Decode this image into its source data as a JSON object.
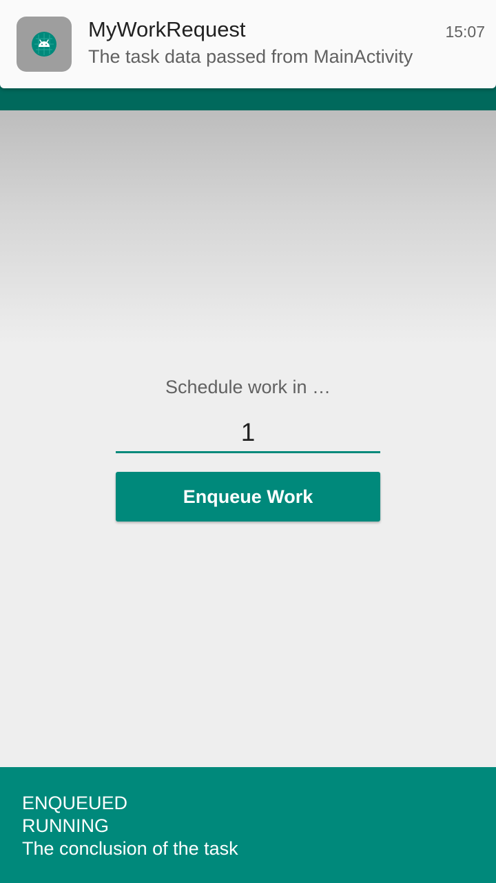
{
  "colors": {
    "primary_dark": "#00695c",
    "accent": "#00897b",
    "background": "#eeeeee",
    "notification_bg": "#fafafa"
  },
  "notification": {
    "app_icon": "android-icon",
    "title": "MyWorkRequest",
    "text": "The task data passed from MainActivity",
    "time": "15:07"
  },
  "main": {
    "schedule_label": "Schedule work in …",
    "delay_value": "1",
    "enqueue_button_label": "Enqueue Work"
  },
  "status": {
    "lines": [
      "ENQUEUED",
      "RUNNING",
      "The conclusion of the task"
    ]
  }
}
